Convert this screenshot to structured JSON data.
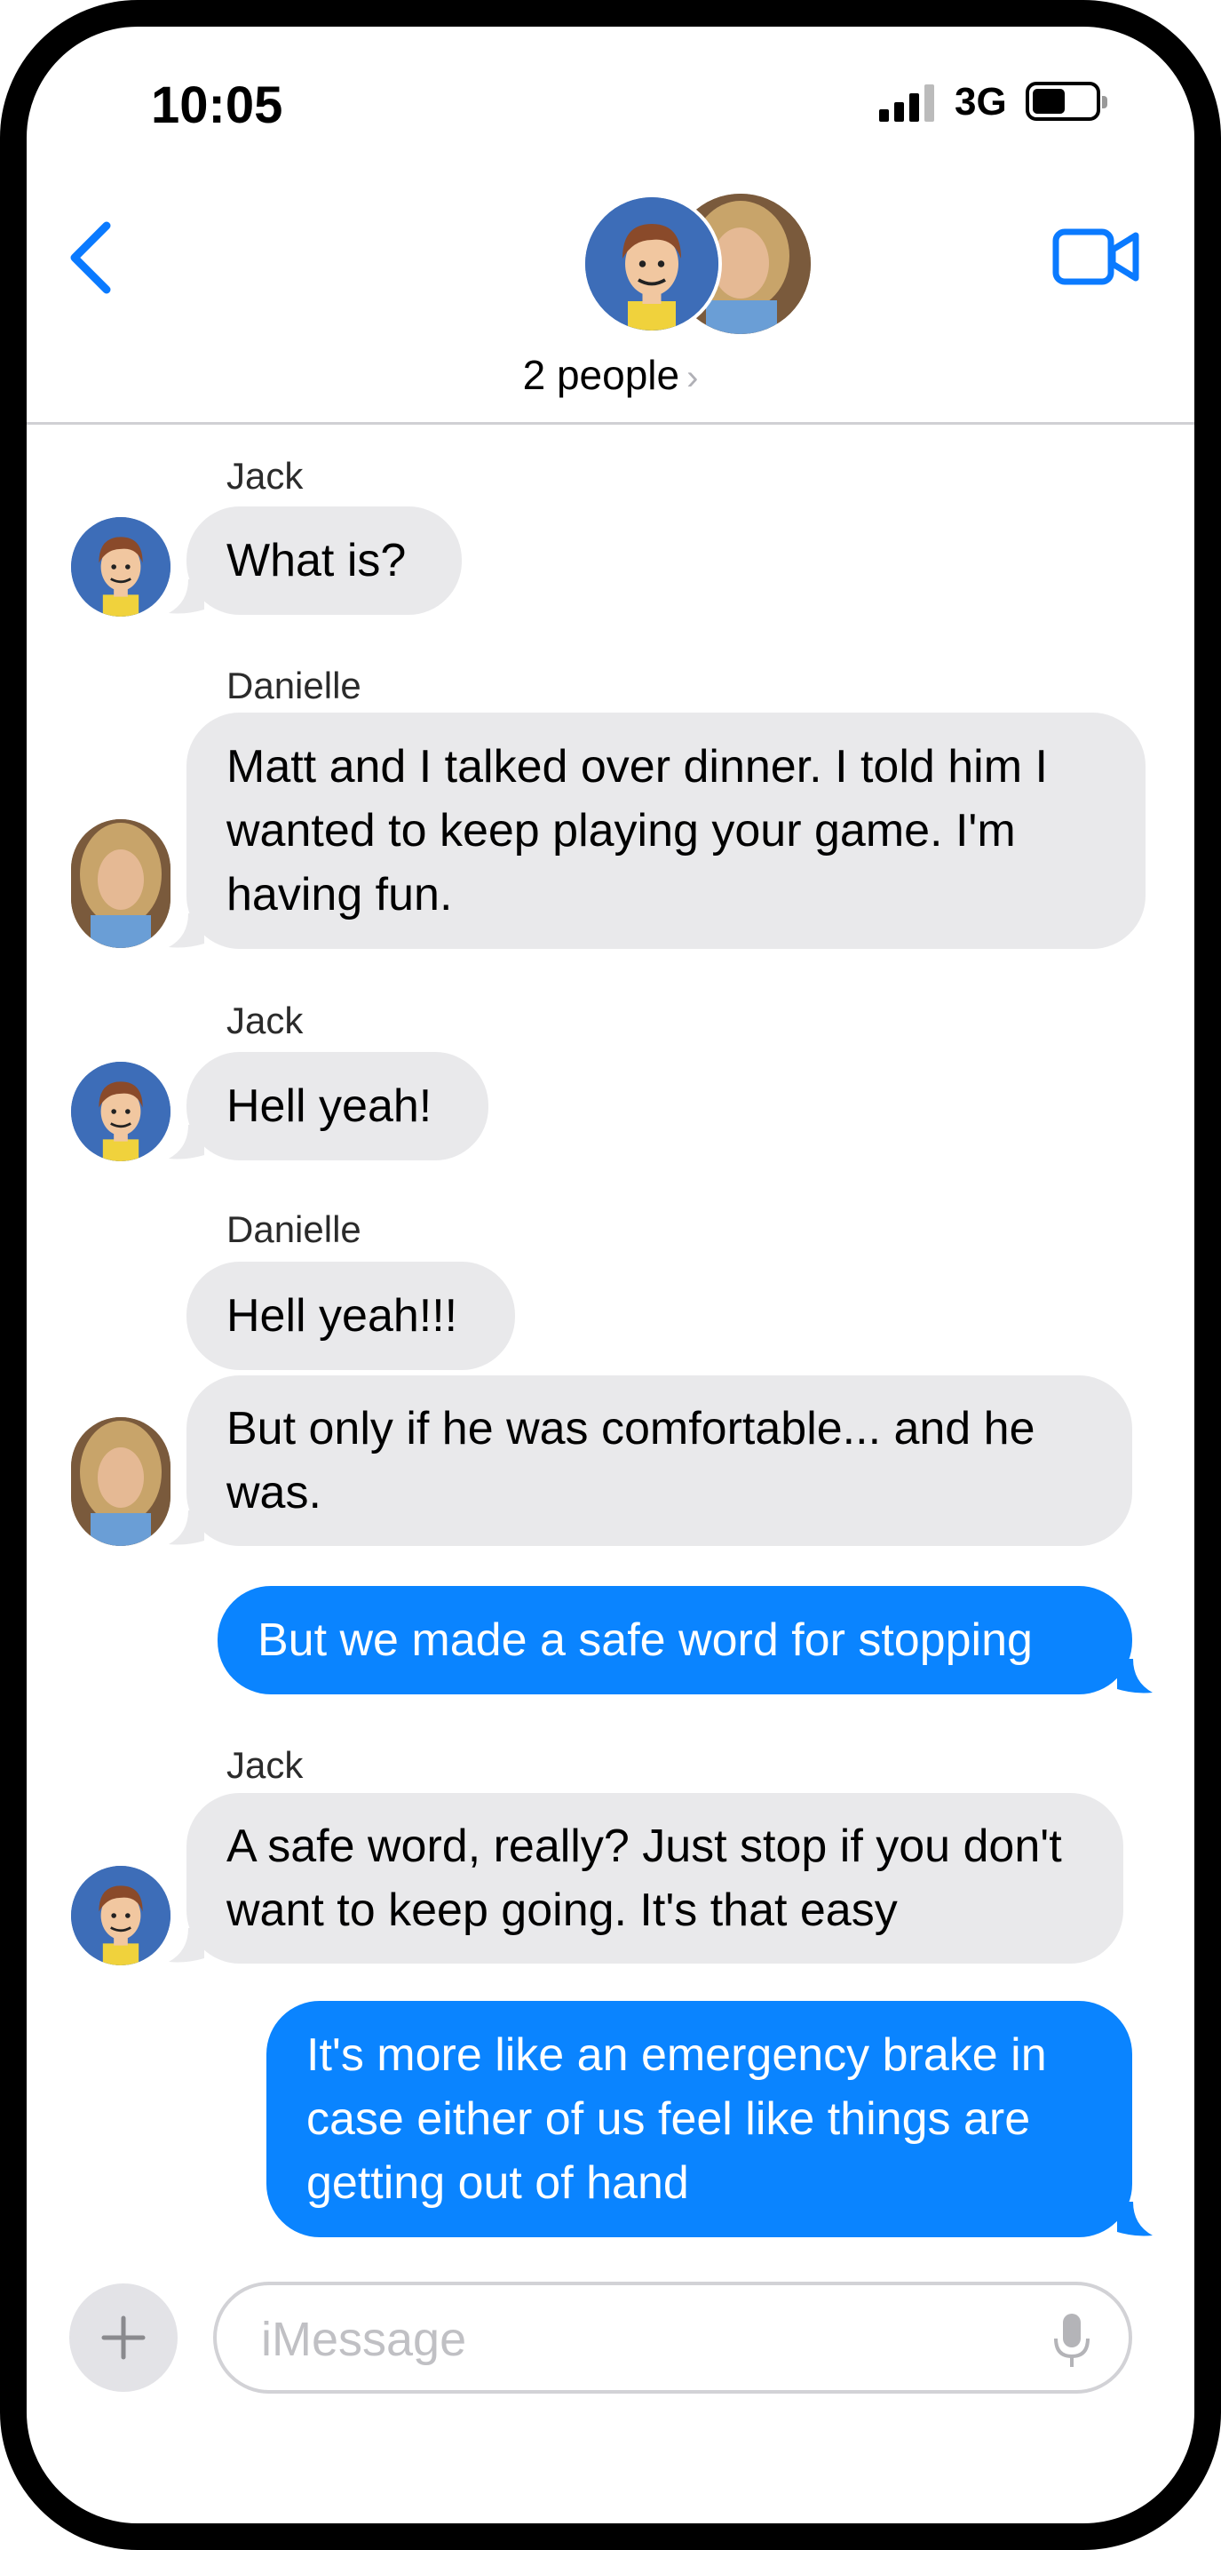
{
  "status_bar": {
    "time": "10:05",
    "network": "3G",
    "signal-icon": "signal-bars-icon",
    "battery-icon": "battery-icon"
  },
  "header": {
    "back_icon": "chevron-left-icon",
    "video_icon": "video-camera-icon",
    "participants_label": "2 people",
    "chevron": "›"
  },
  "messages": [
    {
      "sender": "Jack",
      "direction": "in",
      "text": "What is?"
    },
    {
      "sender": "Danielle",
      "direction": "in",
      "text": "Matt and I talked over dinner.  I told him I wanted to keep playing your game.  I'm having fun."
    },
    {
      "sender": "Jack",
      "direction": "in",
      "text": "Hell yeah!"
    },
    {
      "sender": "Danielle",
      "direction": "in",
      "text": "Hell yeah!!!"
    },
    {
      "sender": "Danielle",
      "direction": "in",
      "text": "But only if he was comfortable... and he was."
    },
    {
      "sender": "",
      "direction": "out",
      "text": "But we made a safe word for stopping"
    },
    {
      "sender": "Jack",
      "direction": "in",
      "text": "A safe word, really?  Just stop if you don't want to keep going.  It's that easy"
    },
    {
      "sender": "",
      "direction": "out",
      "text": "It's more like an emergency brake in case either of us feel like things are getting out of hand"
    }
  ],
  "composer": {
    "placeholder": "iMessage",
    "plus_icon": "plus-icon",
    "mic_icon": "microphone-icon"
  },
  "colors": {
    "outgoing": "#0a84ff",
    "incoming": "#e9e9eb",
    "accent": "#0a7aff"
  }
}
